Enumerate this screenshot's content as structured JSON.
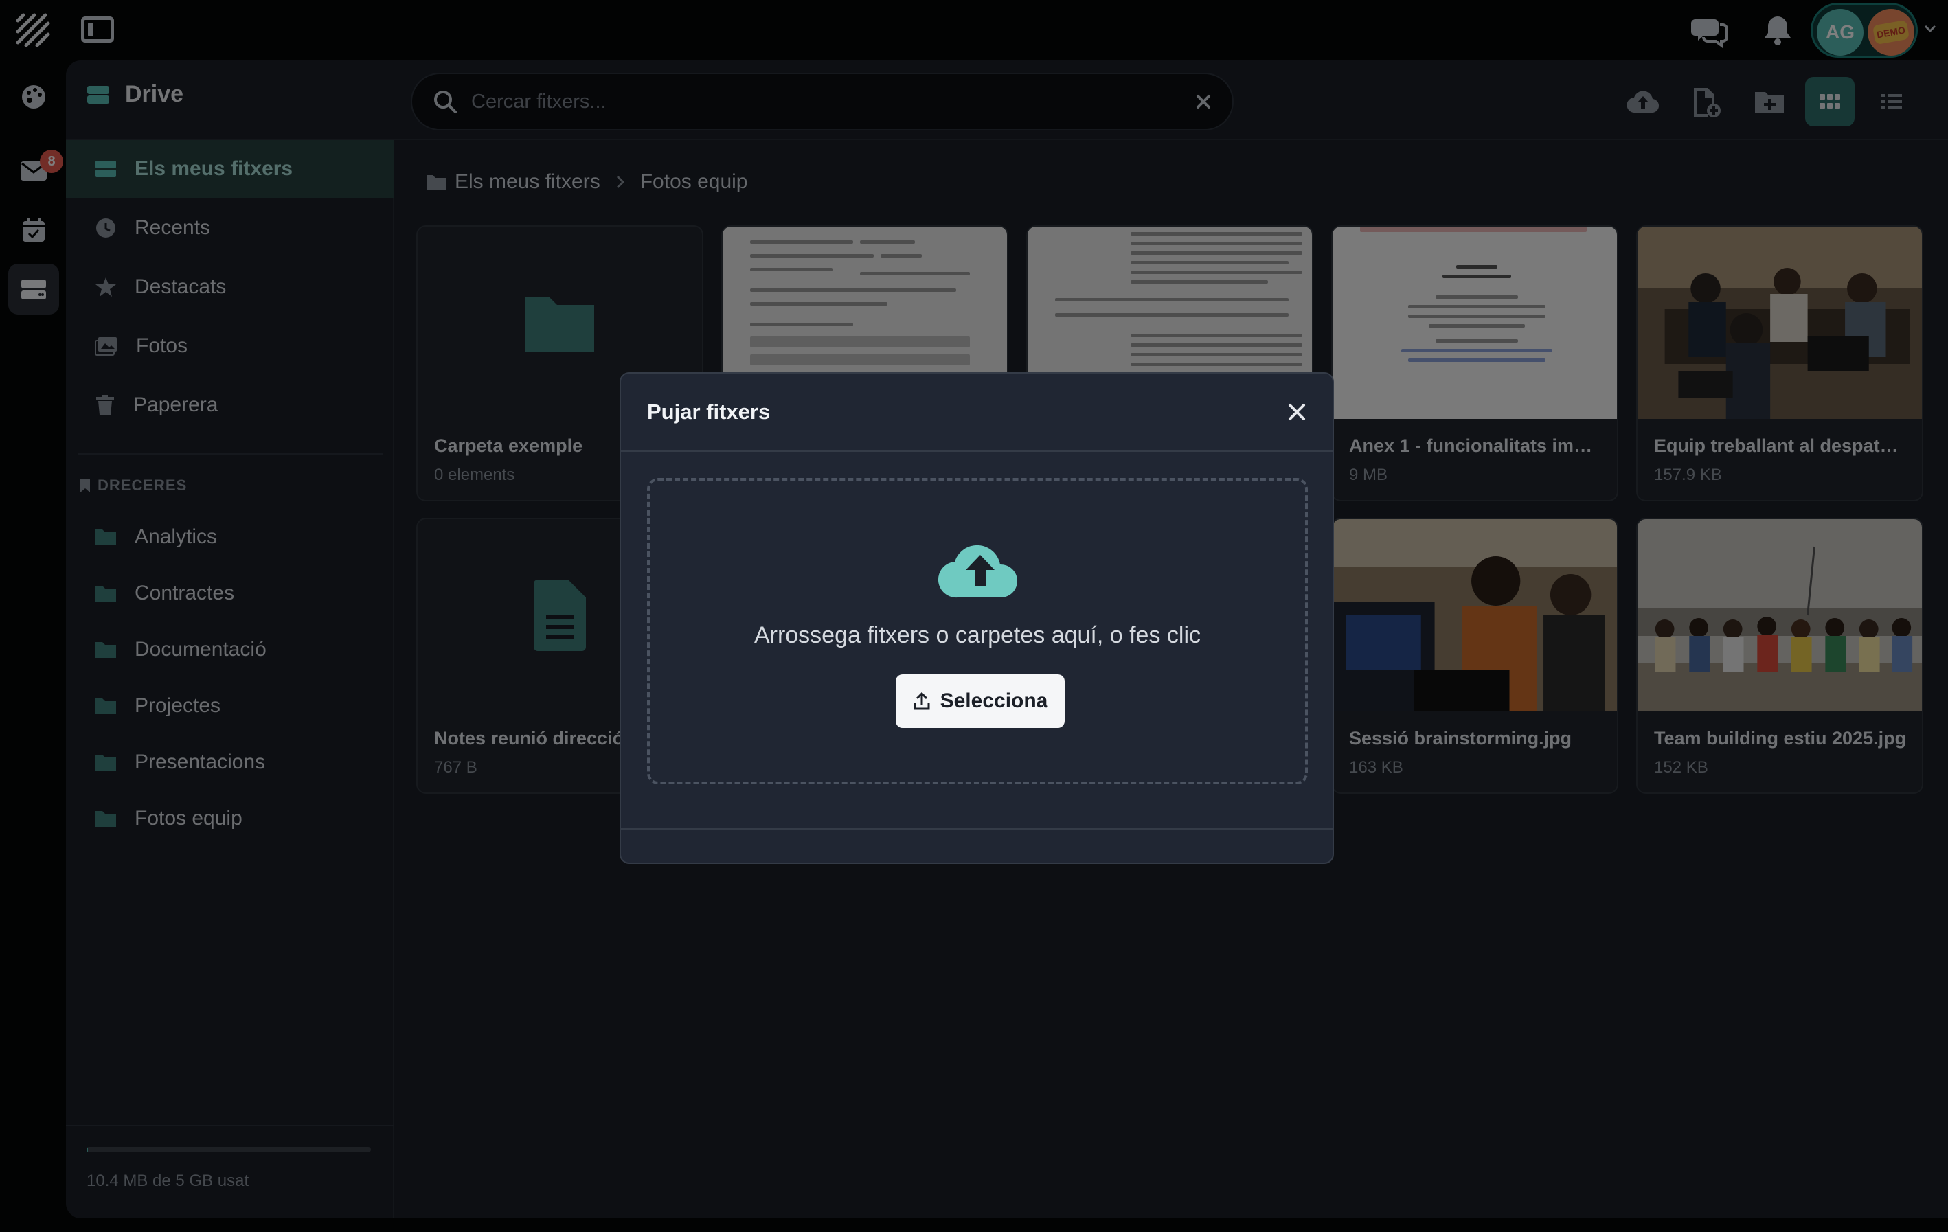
{
  "app": {
    "title": "Drive"
  },
  "header": {
    "avatar_initials": "AG",
    "demo_label": "DEMO",
    "rail_badge_count": "8"
  },
  "search": {
    "placeholder": "Cercar fitxers..."
  },
  "sidebar": {
    "items": [
      {
        "label": "Els meus fitxers",
        "icon": "drive-icon",
        "active": true
      },
      {
        "label": "Recents",
        "icon": "clock-icon"
      },
      {
        "label": "Destacats",
        "icon": "star-icon"
      },
      {
        "label": "Fotos",
        "icon": "photos-icon"
      },
      {
        "label": "Paperera",
        "icon": "trash-icon"
      }
    ],
    "shortcuts_label": "DRECERES",
    "shortcuts": [
      {
        "label": "Analytics"
      },
      {
        "label": "Contractes"
      },
      {
        "label": "Documentació"
      },
      {
        "label": "Projectes"
      },
      {
        "label": "Presentacions"
      },
      {
        "label": "Fotos equip"
      }
    ],
    "storage_text": "10.4 MB de 5 GB usat",
    "storage_used_fraction": 0.002
  },
  "breadcrumb": {
    "root": "Els meus fitxers",
    "current": "Fotos equip"
  },
  "files": [
    {
      "name": "Carpeta exemple",
      "meta": "0 elements",
      "type": "folder"
    },
    {
      "name": "",
      "meta": "",
      "type": "document"
    },
    {
      "name": "",
      "meta": "",
      "type": "document"
    },
    {
      "name": "Anex 1 - funcionalitats impl...",
      "meta": "9 MB",
      "type": "document"
    },
    {
      "name": "Equip treballant al despatx.j...",
      "meta": "157.9 KB",
      "type": "image"
    },
    {
      "name": "Notes reunió direcció",
      "meta": "767 B",
      "type": "text"
    },
    {
      "name": "Sessió brainstorming.jpg",
      "meta": "163 KB",
      "type": "image"
    },
    {
      "name": "Team building estiu 2025.jpg",
      "meta": "152 KB",
      "type": "image"
    }
  ],
  "modal": {
    "title": "Pujar fitxers",
    "drop_text": "Arrossega fitxers o carpetes aquí, o fes clic",
    "select_label": "Selecciona"
  },
  "colors": {
    "accent": "#58bdb4",
    "active_bg": "#27403f",
    "badge": "#e55b4f"
  }
}
